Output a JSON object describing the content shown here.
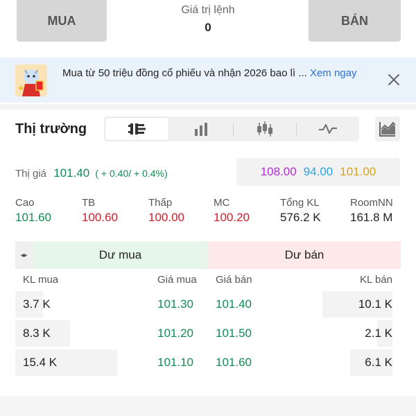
{
  "top": {
    "buy_label": "MUA",
    "sell_label": "BÁN",
    "order_value_label": "Giá trị lệnh",
    "order_value": "0"
  },
  "banner": {
    "text": "Mua từ 50 triệu đồng cổ phiếu và nhận 2026 bao lì ... ",
    "link": "Xem ngay",
    "image_icon": "promo-mascot-icon",
    "close_icon": "close-icon"
  },
  "market": {
    "title": "Thị trường",
    "views": [
      {
        "icon": "order-book-icon",
        "active": true
      },
      {
        "icon": "bar-chart-icon",
        "active": false
      },
      {
        "icon": "candlestick-icon",
        "active": false
      },
      {
        "icon": "line-chart-icon",
        "active": false
      }
    ],
    "chart_button_icon": "area-chart-icon"
  },
  "price": {
    "label": "Thị giá",
    "value": "101.40",
    "change": "( + 0.40/ + 0.4%)",
    "ceiling": "108.00",
    "floor": "94.00",
    "reference": "101.00"
  },
  "stats": [
    {
      "label": "Cao",
      "value": "101.60",
      "color": "green"
    },
    {
      "label": "TB",
      "value": "100.60",
      "color": "red"
    },
    {
      "label": "Thấp",
      "value": "100.00",
      "color": "red"
    },
    {
      "label": "MC",
      "value": "100.20",
      "color": "red"
    },
    {
      "label": "Tổng KL",
      "value": "576.2 K",
      "color": "dark"
    },
    {
      "label": "RoomNN",
      "value": "161.8 M",
      "color": "dark"
    }
  ],
  "orderbook": {
    "toggle_icon": "expand-arrows-icon",
    "buy_title": "Dư mua",
    "sell_title": "Dư bán",
    "columns": {
      "buy_vol": "KL mua",
      "buy_price": "Giá mua",
      "sell_price": "Giá bán",
      "sell_vol": "KL bán"
    },
    "rows": [
      {
        "buy_vol": "3.7 K",
        "buy_price": "101.30",
        "sell_price": "101.40",
        "sell_vol": "10.1 K",
        "buy_ratio": 0.27,
        "sell_ratio": 0.61
      },
      {
        "buy_vol": "8.3 K",
        "buy_price": "101.20",
        "sell_price": "101.50",
        "sell_vol": "2.1 K",
        "buy_ratio": 0.54,
        "sell_ratio": 0.13
      },
      {
        "buy_vol": "15.4 K",
        "buy_price": "101.10",
        "sell_price": "101.60",
        "sell_vol": "6.1 K",
        "buy_ratio": 1.0,
        "sell_ratio": 0.37
      }
    ]
  },
  "colors": {
    "green": "#138c56",
    "red": "#c8202b",
    "ceiling": "#b02fd0",
    "floor": "#2aa4e0",
    "reference": "#d9a21b"
  }
}
